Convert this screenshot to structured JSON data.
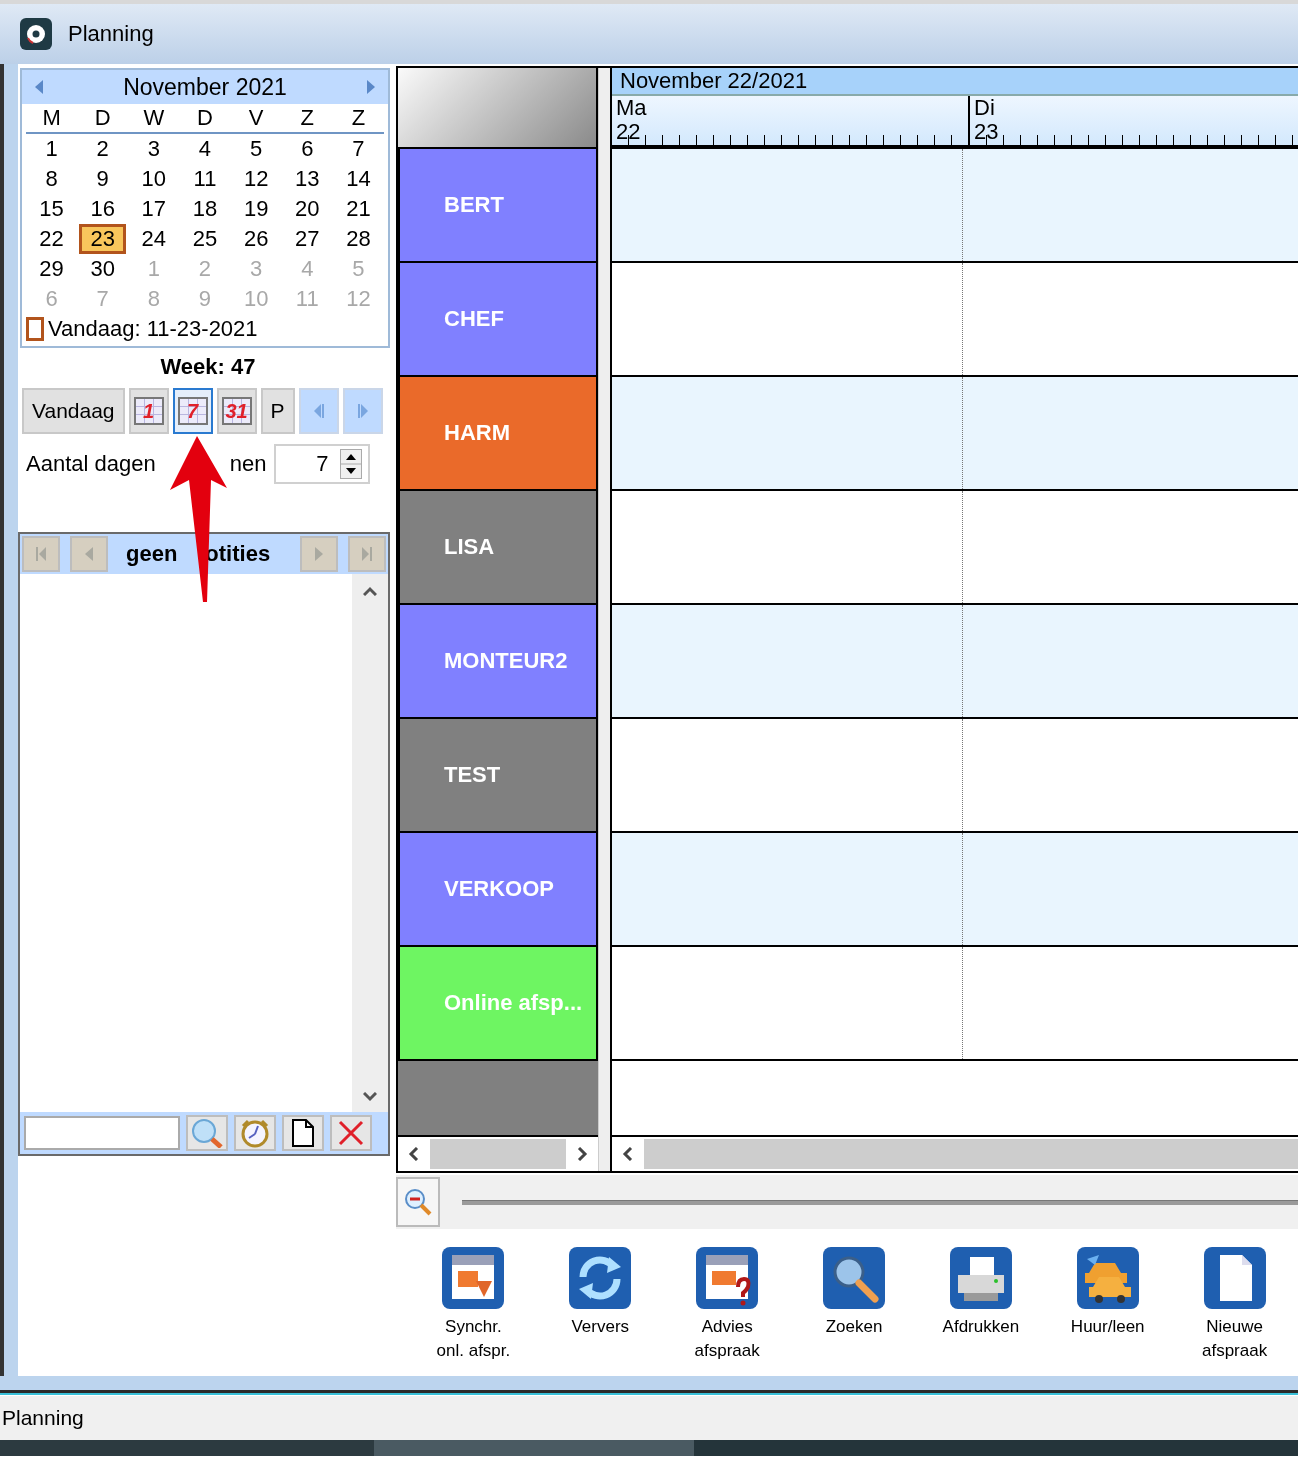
{
  "window": {
    "title": "Planning"
  },
  "calendar": {
    "month": "November 2021",
    "weekdays": [
      "M",
      "D",
      "W",
      "D",
      "V",
      "Z",
      "Z"
    ],
    "weeks": [
      [
        {
          "day": "1",
          "muted": false,
          "selected": false
        },
        {
          "day": "2",
          "muted": false,
          "selected": false
        },
        {
          "day": "3",
          "muted": false,
          "selected": false
        },
        {
          "day": "4",
          "muted": false,
          "selected": false
        },
        {
          "day": "5",
          "muted": false,
          "selected": false
        },
        {
          "day": "6",
          "muted": false,
          "selected": false
        },
        {
          "day": "7",
          "muted": false,
          "selected": false
        }
      ],
      [
        {
          "day": "8",
          "muted": false,
          "selected": false
        },
        {
          "day": "9",
          "muted": false,
          "selected": false
        },
        {
          "day": "10",
          "muted": false,
          "selected": false
        },
        {
          "day": "11",
          "muted": false,
          "selected": false
        },
        {
          "day": "12",
          "muted": false,
          "selected": false
        },
        {
          "day": "13",
          "muted": false,
          "selected": false
        },
        {
          "day": "14",
          "muted": false,
          "selected": false
        }
      ],
      [
        {
          "day": "15",
          "muted": false,
          "selected": false
        },
        {
          "day": "16",
          "muted": false,
          "selected": false
        },
        {
          "day": "17",
          "muted": false,
          "selected": false
        },
        {
          "day": "18",
          "muted": false,
          "selected": false
        },
        {
          "day": "19",
          "muted": false,
          "selected": false
        },
        {
          "day": "20",
          "muted": false,
          "selected": false
        },
        {
          "day": "21",
          "muted": false,
          "selected": false
        }
      ],
      [
        {
          "day": "22",
          "muted": false,
          "selected": false
        },
        {
          "day": "23",
          "muted": false,
          "selected": true
        },
        {
          "day": "24",
          "muted": false,
          "selected": false
        },
        {
          "day": "25",
          "muted": false,
          "selected": false
        },
        {
          "day": "26",
          "muted": false,
          "selected": false
        },
        {
          "day": "27",
          "muted": false,
          "selected": false
        },
        {
          "day": "28",
          "muted": false,
          "selected": false
        }
      ],
      [
        {
          "day": "29",
          "muted": false,
          "selected": false
        },
        {
          "day": "30",
          "muted": false,
          "selected": false
        },
        {
          "day": "1",
          "muted": true,
          "selected": false
        },
        {
          "day": "2",
          "muted": true,
          "selected": false
        },
        {
          "day": "3",
          "muted": true,
          "selected": false
        },
        {
          "day": "4",
          "muted": true,
          "selected": false
        },
        {
          "day": "5",
          "muted": true,
          "selected": false
        }
      ],
      [
        {
          "day": "6",
          "muted": true,
          "selected": false
        },
        {
          "day": "7",
          "muted": true,
          "selected": false
        },
        {
          "day": "8",
          "muted": true,
          "selected": false
        },
        {
          "day": "9",
          "muted": true,
          "selected": false
        },
        {
          "day": "10",
          "muted": true,
          "selected": false
        },
        {
          "day": "11",
          "muted": true,
          "selected": false
        },
        {
          "day": "12",
          "muted": true,
          "selected": false
        }
      ]
    ],
    "today_label": "Vandaag: 11-23-2021"
  },
  "week_label": "Week: 47",
  "view_buttons": [
    {
      "kind": "text",
      "label": "Vandaag",
      "selected": false
    },
    {
      "kind": "calendar",
      "label": "1",
      "selected": false
    },
    {
      "kind": "calendar",
      "label": "7",
      "selected": true
    },
    {
      "kind": "calendar",
      "label": "31",
      "selected": false
    },
    {
      "kind": "text",
      "label": "P",
      "selected": false
    },
    {
      "kind": "previous",
      "selected": false
    },
    {
      "kind": "next",
      "selected": false
    }
  ],
  "days_to_show": {
    "label_parts": [
      "Aantal dagen",
      "nen"
    ],
    "value": "7"
  },
  "notes": {
    "title_parts": [
      "geen",
      "otities"
    ]
  },
  "planner": {
    "date_header": "November 22/2021",
    "days": [
      {
        "name": "Ma",
        "date": "22"
      },
      {
        "name": "Di",
        "date": "23"
      }
    ],
    "resources": [
      {
        "name": "BERT",
        "color": "#8080ff"
      },
      {
        "name": "CHEF",
        "color": "#8080ff"
      },
      {
        "name": "HARM",
        "color": "#ea6a2a"
      },
      {
        "name": "LISA",
        "color": "#808080"
      },
      {
        "name": "MONTEUR2",
        "color": "#8080ff"
      },
      {
        "name": "TEST",
        "color": "#808080"
      },
      {
        "name": "VERKOOP",
        "color": "#8080ff"
      },
      {
        "name": "Online afsp...",
        "color": "#6ef562"
      }
    ]
  },
  "toolbar": [
    {
      "kind": "sync",
      "label": "Synchr.\nonl. afspr."
    },
    {
      "kind": "refresh",
      "label": "Ververs"
    },
    {
      "kind": "advice",
      "label": "Advies\nafspraak"
    },
    {
      "kind": "search",
      "label": "Zoeken"
    },
    {
      "kind": "print",
      "label": "Afdrukken"
    },
    {
      "kind": "cars",
      "label": "Huur/leen"
    },
    {
      "kind": "new",
      "label": "Nieuwe\nafspraak"
    }
  ],
  "status_bar": {
    "text": "Planning"
  }
}
